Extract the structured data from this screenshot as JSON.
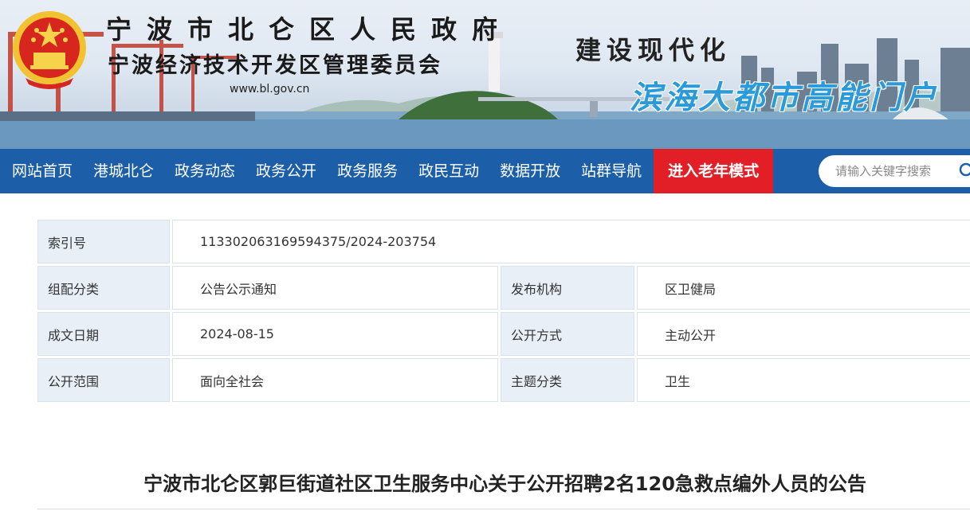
{
  "header": {
    "gov_name": "宁波市北仑区人民政府",
    "gov_subname": "宁波经济技术开发区管理委员会",
    "url": "www.bl.gov.cn",
    "slogan_line1": "建设现代化",
    "slogan_line2": "滨海大都市高能门户"
  },
  "nav": {
    "items": [
      "网站首页",
      "港城北仑",
      "政务动态",
      "政务公开",
      "政务服务",
      "政民互动",
      "数据开放",
      "站群导航"
    ],
    "elder_mode": "进入老年模式",
    "search_placeholder": "请输入关键字搜索"
  },
  "info": {
    "index_label": "索引号",
    "index_value": "113302063169594375/2024-203754",
    "category_label": "组配分类",
    "category_value": "公告公示通知",
    "publisher_label": "发布机构",
    "publisher_value": "区卫健局",
    "date_label": "成文日期",
    "date_value": "2024-08-15",
    "open_method_label": "公开方式",
    "open_method_value": "主动公开",
    "scope_label": "公开范围",
    "scope_value": "面向全社会",
    "topic_label": "主题分类",
    "topic_value": "卫生"
  },
  "article": {
    "title": "宁波市北仑区郭巨街道社区卫生服务中心关于公开招聘2名120急救点编外人员的公告"
  },
  "colors": {
    "nav_bg": "#1c5ea8",
    "elder_bg": "#e21f26",
    "label_bg": "#e8eff7",
    "slogan_blue": "#2a9ad8"
  }
}
